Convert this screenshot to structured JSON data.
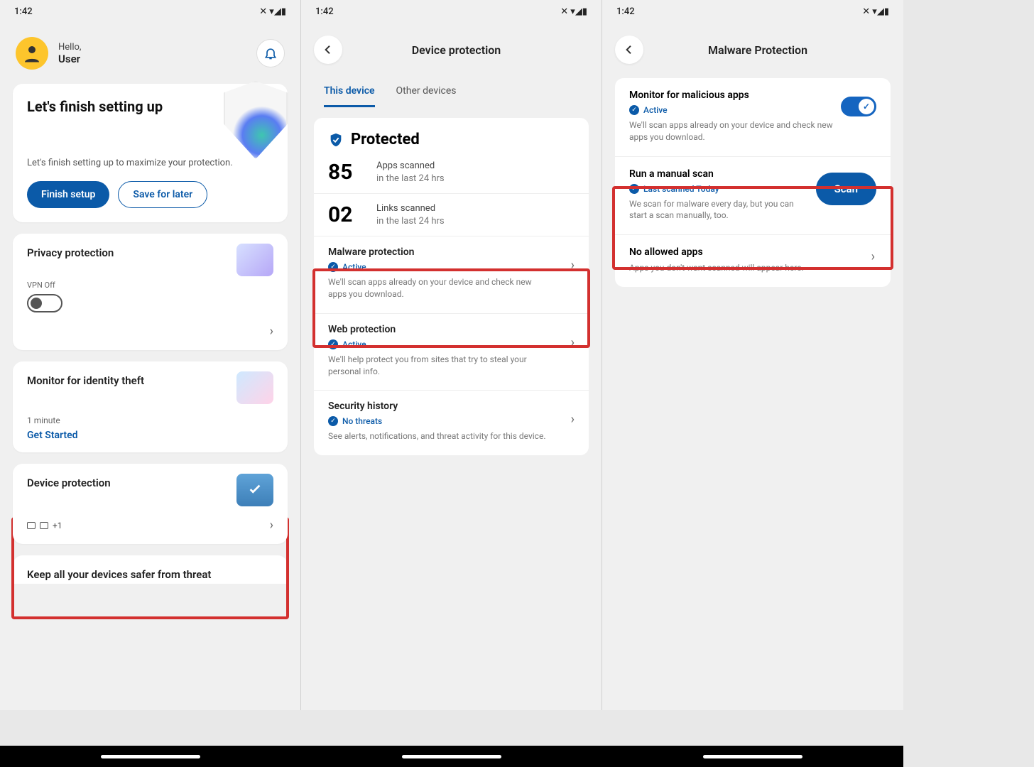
{
  "status": {
    "time": "1:42",
    "icons": "✕ ▾◢▮"
  },
  "screen1": {
    "hello": "Hello,",
    "user": "User",
    "setup": {
      "title": "Let's finish setting up",
      "subtitle": "Let's finish setting up to maximize your protection.",
      "finish": "Finish setup",
      "later": "Save for later"
    },
    "privacy": {
      "title": "Privacy protection",
      "vpn_label": "VPN Off"
    },
    "identity": {
      "title": "Monitor for identity theft",
      "time": "1 minute",
      "cta": "Get Started"
    },
    "device": {
      "title": "Device protection",
      "count": "+1"
    },
    "keep": "Keep all your devices safer from threat"
  },
  "screen2": {
    "header": "Device protection",
    "tabs": {
      "this": "This device",
      "other": "Other devices"
    },
    "protected": "Protected",
    "stats": {
      "apps_num": "85",
      "apps_l1": "Apps scanned",
      "apps_l2": "in the last 24 hrs",
      "links_num": "02",
      "links_l1": "Links scanned",
      "links_l2": "in the last 24 hrs"
    },
    "malware": {
      "title": "Malware protection",
      "status": "Active",
      "desc": "We'll scan apps already on your device and check new apps you download."
    },
    "web": {
      "title": "Web protection",
      "status": "Active",
      "desc": "We'll help protect you from sites that try to steal your personal info."
    },
    "history": {
      "title": "Security history",
      "status": "No threats",
      "desc": "See alerts, notifications, and threat activity for this device."
    }
  },
  "screen3": {
    "header": "Malware Protection",
    "monitor": {
      "title": "Monitor for malicious apps",
      "status": "Active",
      "desc": "We'll scan apps already on your device and check new apps you download."
    },
    "manual": {
      "title": "Run a manual scan",
      "status": "Last scanned Today",
      "desc": "We scan for malware every day, but you can start a scan manually, too.",
      "button": "Scan"
    },
    "allowed": {
      "title": "No allowed apps",
      "desc": "Apps you don't want scanned will appear here."
    }
  }
}
